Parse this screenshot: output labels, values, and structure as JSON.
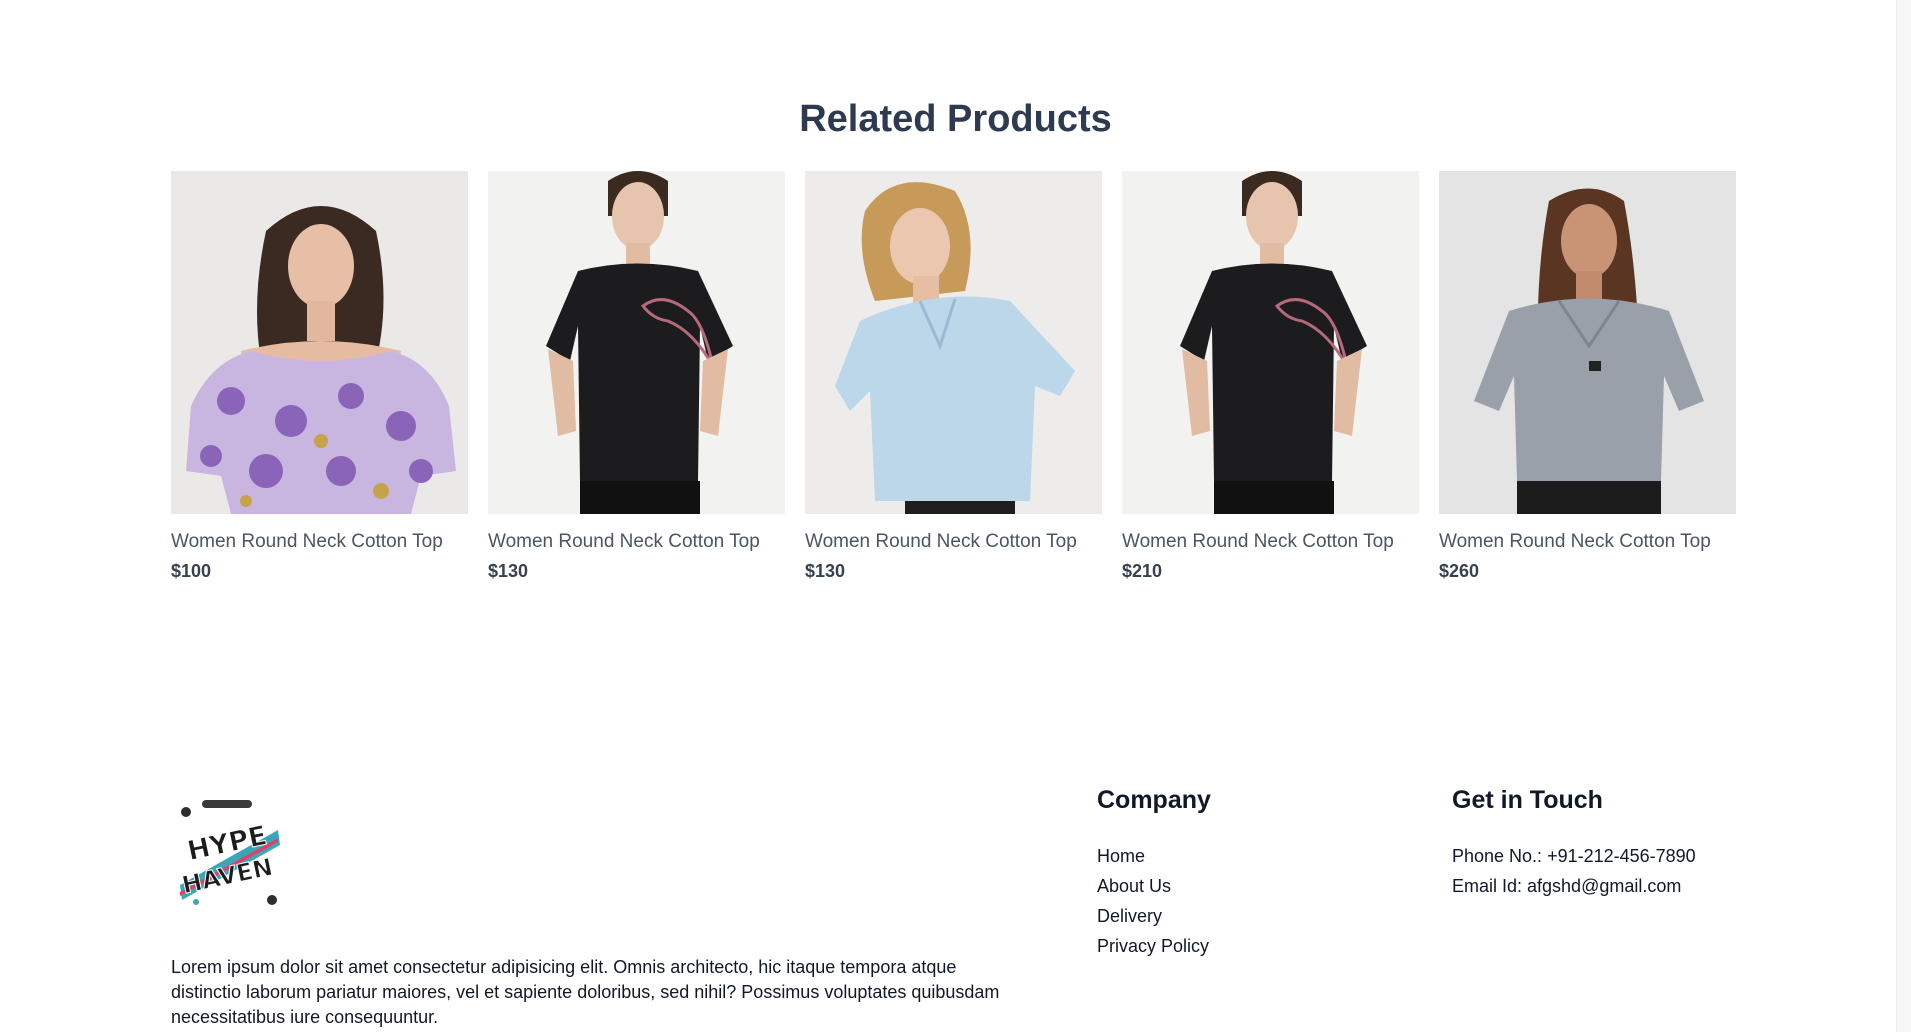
{
  "related": {
    "title": "Related Products",
    "products": [
      {
        "name": "Women Round Neck Cotton Top",
        "price": "$100",
        "image": "floral-off-shoulder-top"
      },
      {
        "name": "Women Round Neck Cotton Top",
        "price": "$130",
        "image": "black-puma-tee"
      },
      {
        "name": "Women Round Neck Cotton Top",
        "price": "$130",
        "image": "light-blue-collar-top"
      },
      {
        "name": "Women Round Neck Cotton Top",
        "price": "$210",
        "image": "black-puma-tee"
      },
      {
        "name": "Women Round Neck Cotton Top",
        "price": "$260",
        "image": "grey-v-neck-top"
      }
    ]
  },
  "footer": {
    "logo_text": "HYPE HAVEN",
    "about": "Lorem ipsum dolor sit amet consectetur adipisicing elit. Omnis architecto, hic itaque tempora atque distinctio laborum pariatur maiores, vel et sapiente doloribus, sed nihil? Possimus voluptates quibusdam necessitatibus iure consequuntur.",
    "company": {
      "title": "Company",
      "links": [
        "Home",
        "About Us",
        "Delivery",
        "Privacy Policy"
      ]
    },
    "contact": {
      "title": "Get in Touch",
      "phone": "Phone No.: +91-212-456-7890",
      "email": "Email Id: afgshd@gmail.com"
    }
  },
  "colors": {
    "title": "#2e3a4f",
    "text": "#111827",
    "muted": "#4b5563"
  }
}
